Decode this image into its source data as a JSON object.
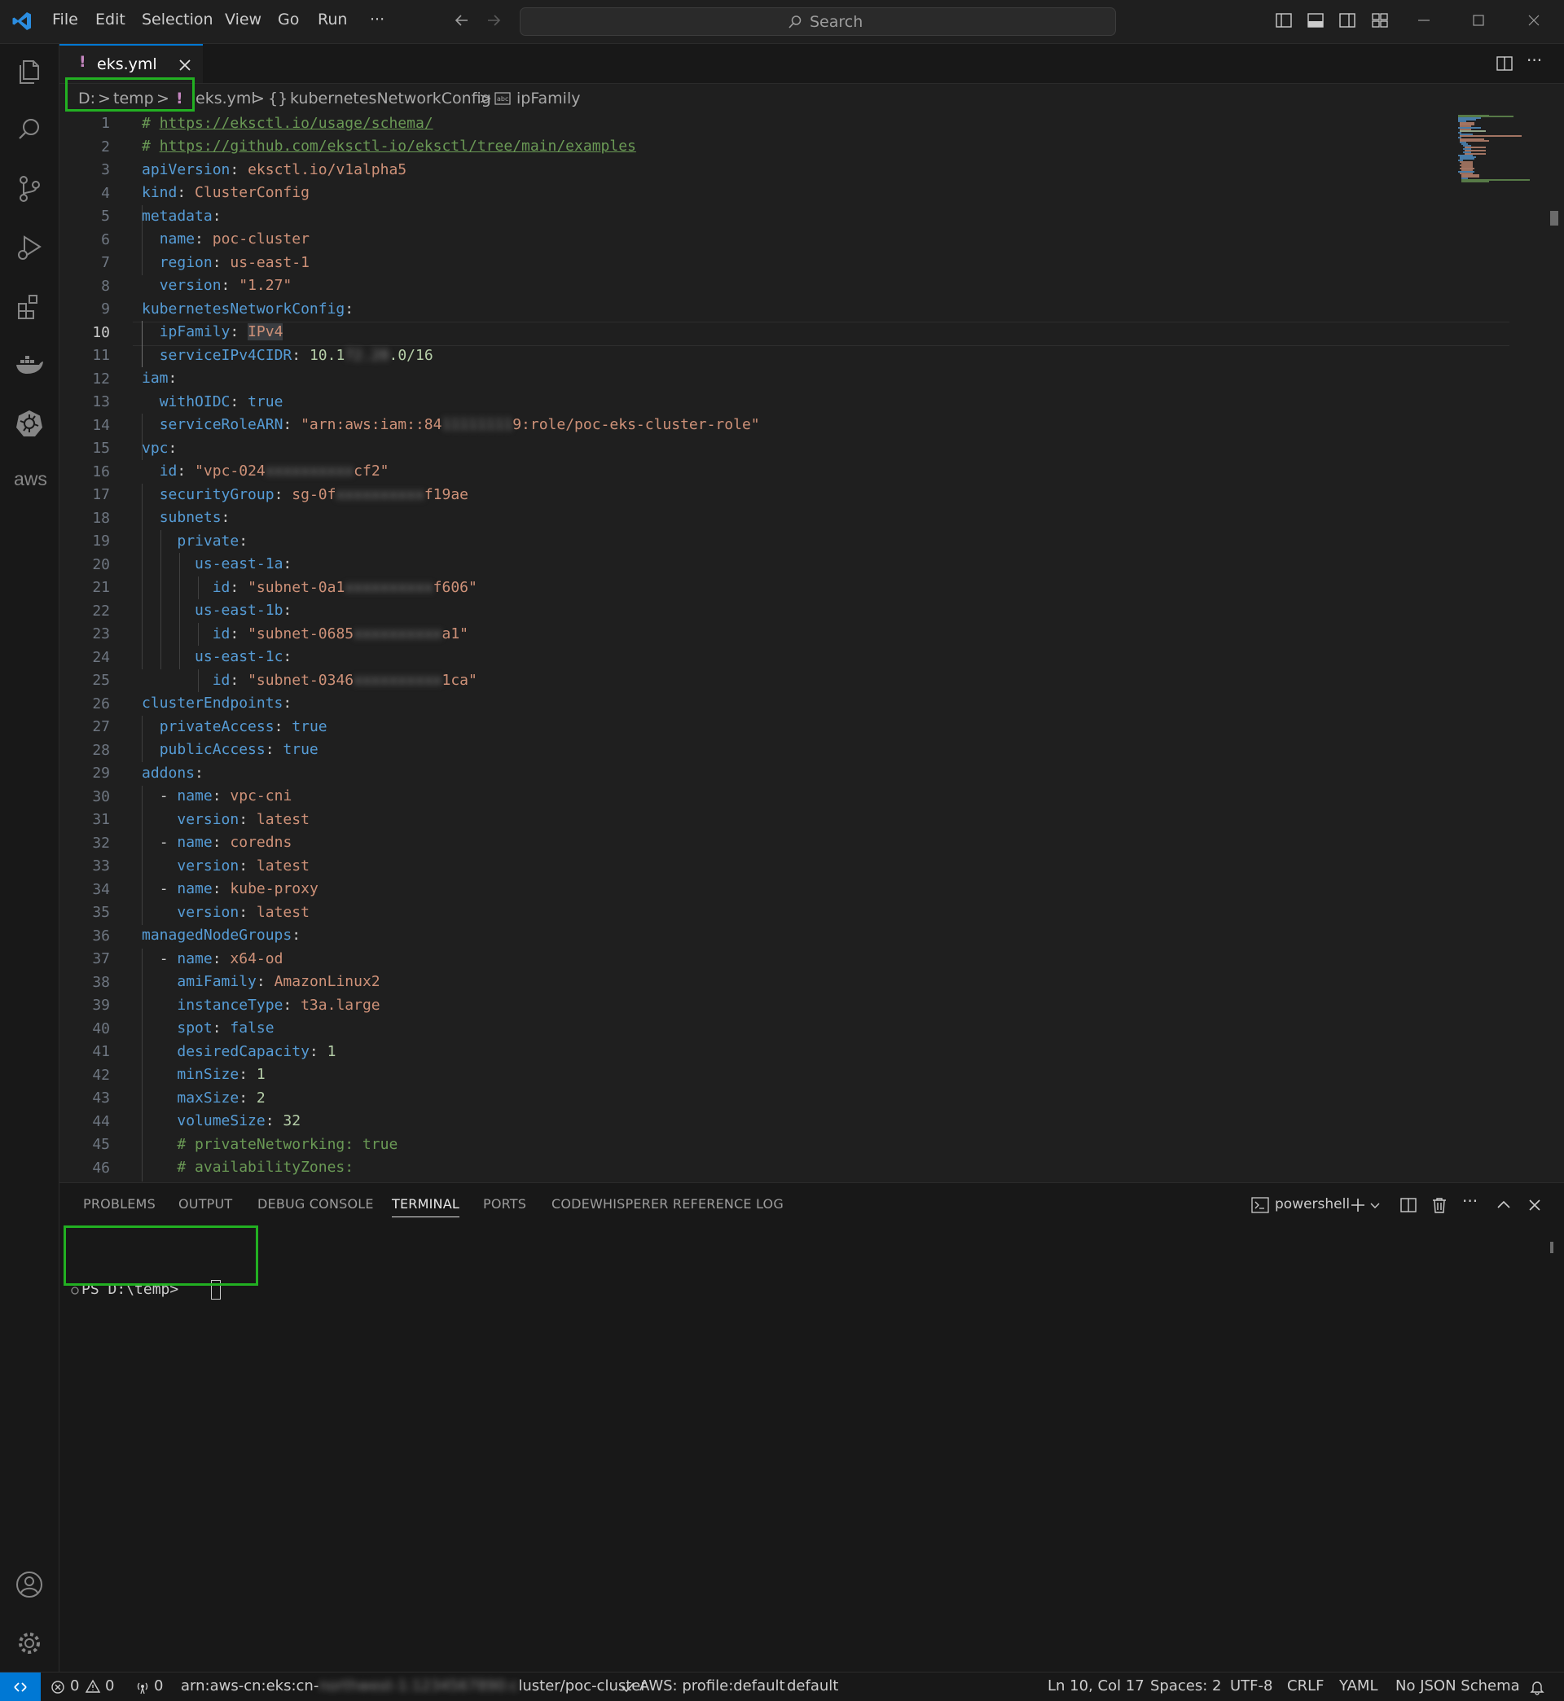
{
  "titlebar": {
    "menu": [
      "File",
      "Edit",
      "Selection",
      "View",
      "Go",
      "Run",
      "···"
    ],
    "search_placeholder": "Search"
  },
  "tab": {
    "filename": "eks.yml",
    "modified_marker": "!"
  },
  "breadcrumb": {
    "drive": "D:",
    "folder": "temp",
    "file": "eks.yml",
    "object": "kubernetesNetworkConfig",
    "key": "ipFamily",
    "object_glyph": "{}",
    "sep": ">"
  },
  "editor": {
    "current_line": 10,
    "line_numbers": [
      "1",
      "2",
      "3",
      "4",
      "5",
      "6",
      "7",
      "8",
      "9",
      "10",
      "11",
      "12",
      "13",
      "14",
      "15",
      "16",
      "17",
      "18",
      "19",
      "20",
      "21",
      "22",
      "23",
      "24",
      "25",
      "26",
      "27",
      "28",
      "29",
      "30",
      "31",
      "32",
      "33",
      "34",
      "35",
      "36",
      "37",
      "38",
      "39",
      "40",
      "41",
      "42",
      "43",
      "44",
      "45",
      "46"
    ],
    "lines": {
      "l1_hash": "# ",
      "l1_url": "https://eksctl.io/usage/schema/",
      "l2_hash": "# ",
      "l2_url": "https://github.com/eksctl-io/eksctl/tree/main/examples",
      "l3_key": "apiVersion",
      "l3_val": "eksctl.io/v1alpha5",
      "l4_key": "kind",
      "l4_val": "ClusterConfig",
      "l5_key": "metadata",
      "l6_key": "name",
      "l6_val": "poc-cluster",
      "l7_key": "region",
      "l7_val": "us-east-1",
      "l8_key": "version",
      "l8_val": "\"1.27\"",
      "l9_key": "kubernetesNetworkConfig",
      "l10_key": "ipFamily",
      "l10_val": "IPv4",
      "l11_key": "serviceIPv4CIDR",
      "l11_a": "10.1",
      "l11_b": "72.20",
      "l11_c": ".0/16",
      "l12_key": "iam",
      "l13_key": "withOIDC",
      "l13_val": "true",
      "l14_key": "serviceRoleARN",
      "l14_a": "\"arn:aws:iam::84",
      "l14_b": "11111111",
      "l14_c": "9:role/poc-eks-cluster-role\"",
      "l15_key": "vpc",
      "l16_key": "id",
      "l16_a": "\"vpc-024",
      "l16_b": "xxxxxxxxxx",
      "l16_c": "cf2\"",
      "l17_key": "securityGroup",
      "l17_a": "sg-0f",
      "l17_b": "xxxxxxxxxx",
      "l17_c": "f19ae",
      "l18_key": "subnets",
      "l19_key": "private",
      "l20_key": "us-east-1a",
      "l21_key": "id",
      "l21_a": "\"subnet-0a1",
      "l21_b": "xxxxxxxxxx",
      "l21_c": "f606\"",
      "l22_key": "us-east-1b",
      "l23_key": "id",
      "l23_a": "\"subnet-0685",
      "l23_b": "xxxxxxxxxx",
      "l23_c": "a1\"",
      "l24_key": "us-east-1c",
      "l25_key": "id",
      "l25_a": "\"subnet-0346",
      "l25_b": "xxxxxxxxxx",
      "l25_c": "1ca\"",
      "l26_key": "clusterEndpoints",
      "l27_key": "privateAccess",
      "l27_val": "true",
      "l28_key": "publicAccess",
      "l28_val": "true",
      "l29_key": "addons",
      "l30_key": "name",
      "l30_val": "vpc-cni",
      "l31_key": "version",
      "l31_val": "latest",
      "l32_key": "name",
      "l32_val": "coredns",
      "l33_key": "version",
      "l33_val": "latest",
      "l34_key": "name",
      "l34_val": "kube-proxy",
      "l35_key": "version",
      "l35_val": "latest",
      "l36_key": "managedNodeGroups",
      "l37_key": "name",
      "l37_val": "x64-od",
      "l38_key": "amiFamily",
      "l38_val": "AmazonLinux2",
      "l39_key": "instanceType",
      "l39_val": "t3a.large",
      "l40_key": "spot",
      "l40_val": "false",
      "l41_key": "desiredCapacity",
      "l41_val": "1",
      "l42_key": "minSize",
      "l42_val": "1",
      "l43_key": "maxSize",
      "l43_val": "2",
      "l44_key": "volumeSize",
      "l44_val": "32",
      "l45_comment": "# privateNetworking: true",
      "l46_comment": "# availabilityZones:"
    }
  },
  "panel": {
    "tabs": [
      "PROBLEMS",
      "OUTPUT",
      "DEBUG CONSOLE",
      "TERMINAL",
      "PORTS",
      "CODEWHISPERER REFERENCE LOG"
    ],
    "active_tab": "TERMINAL",
    "shell": "powershell",
    "prompt": "PS D:\\temp> "
  },
  "statusbar": {
    "errors": "0",
    "warnings": "0",
    "remote_count": "0",
    "arn_prefix": "arn:aws-cn:eks:cn-",
    "arn_hidden": "northwest-1:1234567890:c",
    "arn_suffix": "luster/poc-cluster",
    "aws_profile": "AWS: profile:default",
    "profile": "default",
    "position": "Ln 10, Col 17",
    "spaces": "Spaces: 2",
    "encoding": "UTF-8",
    "eol": "CRLF",
    "language": "YAML",
    "schema": "No JSON Schema"
  },
  "colors": {
    "accent": "#0078d4",
    "highlight_box": "#22b022",
    "key": "#569cd6",
    "string": "#ce9178",
    "comment": "#6a9955",
    "number": "#b5cea8",
    "modified": "#c586c0"
  }
}
